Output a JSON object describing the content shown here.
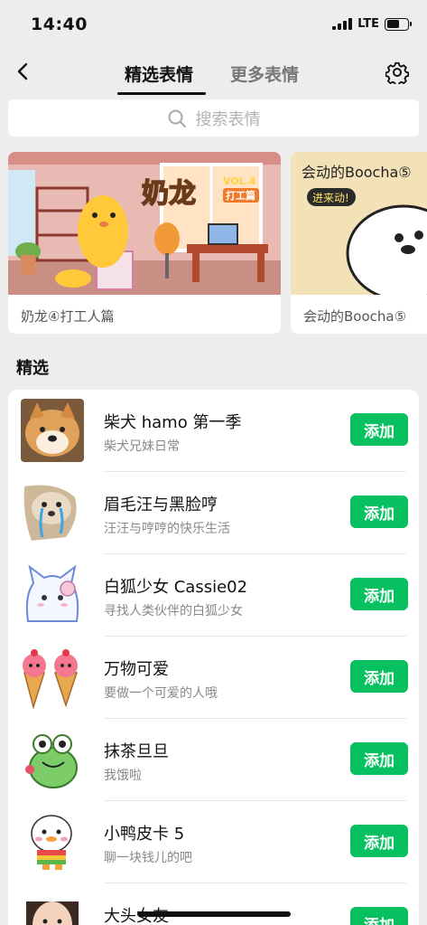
{
  "status": {
    "time": "14:40",
    "network": "LTE"
  },
  "nav": {
    "tab_active": "精选表情",
    "tab_inactive": "更多表情"
  },
  "search": {
    "placeholder": "搜索表情"
  },
  "banners": [
    {
      "caption": "奶龙④打工人篇",
      "art_title": "奶龙",
      "art_tag": "打工篇",
      "art_vol": "VOL.4"
    },
    {
      "caption": "会动的Boocha⑤",
      "art_title": "会动的Boocha⑤",
      "art_tag": "进来动!"
    }
  ],
  "section": {
    "title": "精选"
  },
  "items": [
    {
      "title": "柴犬 hamo 第一季",
      "subtitle": "柴犬兄妹日常",
      "button": "添加",
      "icon": "shiba-dog-sticker"
    },
    {
      "title": "眉毛汪与黑脸哼",
      "subtitle": "汪汪与哼哼的快乐生活",
      "button": "添加",
      "icon": "crying-dog-sticker"
    },
    {
      "title": "白狐少女 Cassie02",
      "subtitle": "寻找人类伙伴的白狐少女",
      "button": "添加",
      "icon": "white-fox-sticker"
    },
    {
      "title": "万物可爱",
      "subtitle": "要做一个可爱的人哦",
      "button": "添加",
      "icon": "ice-cream-sticker"
    },
    {
      "title": "抹茶旦旦",
      "subtitle": "我饿啦",
      "button": "添加",
      "icon": "green-frog-sticker"
    },
    {
      "title": "小鸭皮卡 5",
      "subtitle": "聊一块钱儿的吧",
      "button": "添加",
      "icon": "duck-sticker"
    },
    {
      "title": "大头女友",
      "subtitle": "",
      "button": "添加",
      "icon": "girl-face-sticker"
    }
  ],
  "colors": {
    "accent": "#07c160",
    "background": "#ededed"
  }
}
